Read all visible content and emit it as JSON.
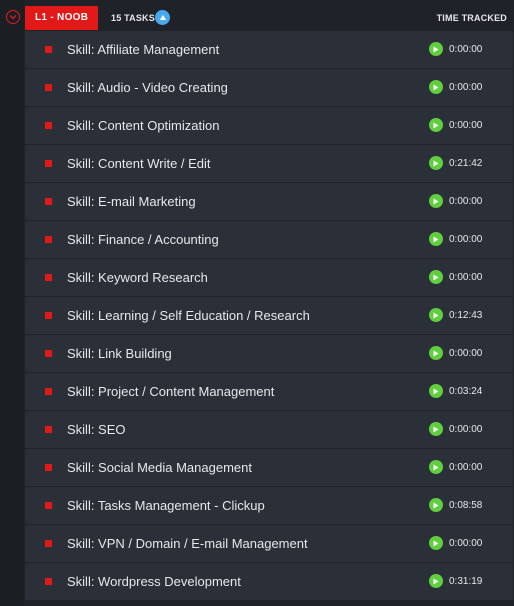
{
  "group": {
    "status_label": "L1 - NOOB",
    "task_count": "15 TASKS",
    "time_column_label": "TIME TRACKED",
    "icons": {
      "collapse": "chevron-down-circle-icon",
      "sort": "arrow-up-icon",
      "play": "play-icon"
    },
    "colors": {
      "status": "#e11919",
      "sort": "#49a9ee",
      "play": "#5fcf3e",
      "row": "#2b3038",
      "background": "#1f2329"
    }
  },
  "tasks": [
    {
      "name": "Skill: Affiliate Management",
      "time": "0:00:00"
    },
    {
      "name": "Skill: Audio - Video Creating",
      "time": "0:00:00"
    },
    {
      "name": "Skill: Content Optimization",
      "time": "0:00:00"
    },
    {
      "name": "Skill: Content Write / Edit",
      "time": "0:21:42"
    },
    {
      "name": "Skill: E-mail Marketing",
      "time": "0:00:00"
    },
    {
      "name": "Skill: Finance / Accounting",
      "time": "0:00:00"
    },
    {
      "name": "Skill: Keyword Research",
      "time": "0:00:00"
    },
    {
      "name": "Skill: Learning / Self Education / Research",
      "time": "0:12:43"
    },
    {
      "name": "Skill: Link Building",
      "time": "0:00:00"
    },
    {
      "name": "Skill: Project / Content Management",
      "time": "0:03:24"
    },
    {
      "name": "Skill: SEO",
      "time": "0:00:00"
    },
    {
      "name": "Skill: Social Media Management",
      "time": "0:00:00"
    },
    {
      "name": "Skill: Tasks Management - Clickup",
      "time": "0:08:58"
    },
    {
      "name": "Skill: VPN / Domain / E-mail Management",
      "time": "0:00:00"
    },
    {
      "name": "Skill: Wordpress Development",
      "time": "0:31:19"
    }
  ]
}
